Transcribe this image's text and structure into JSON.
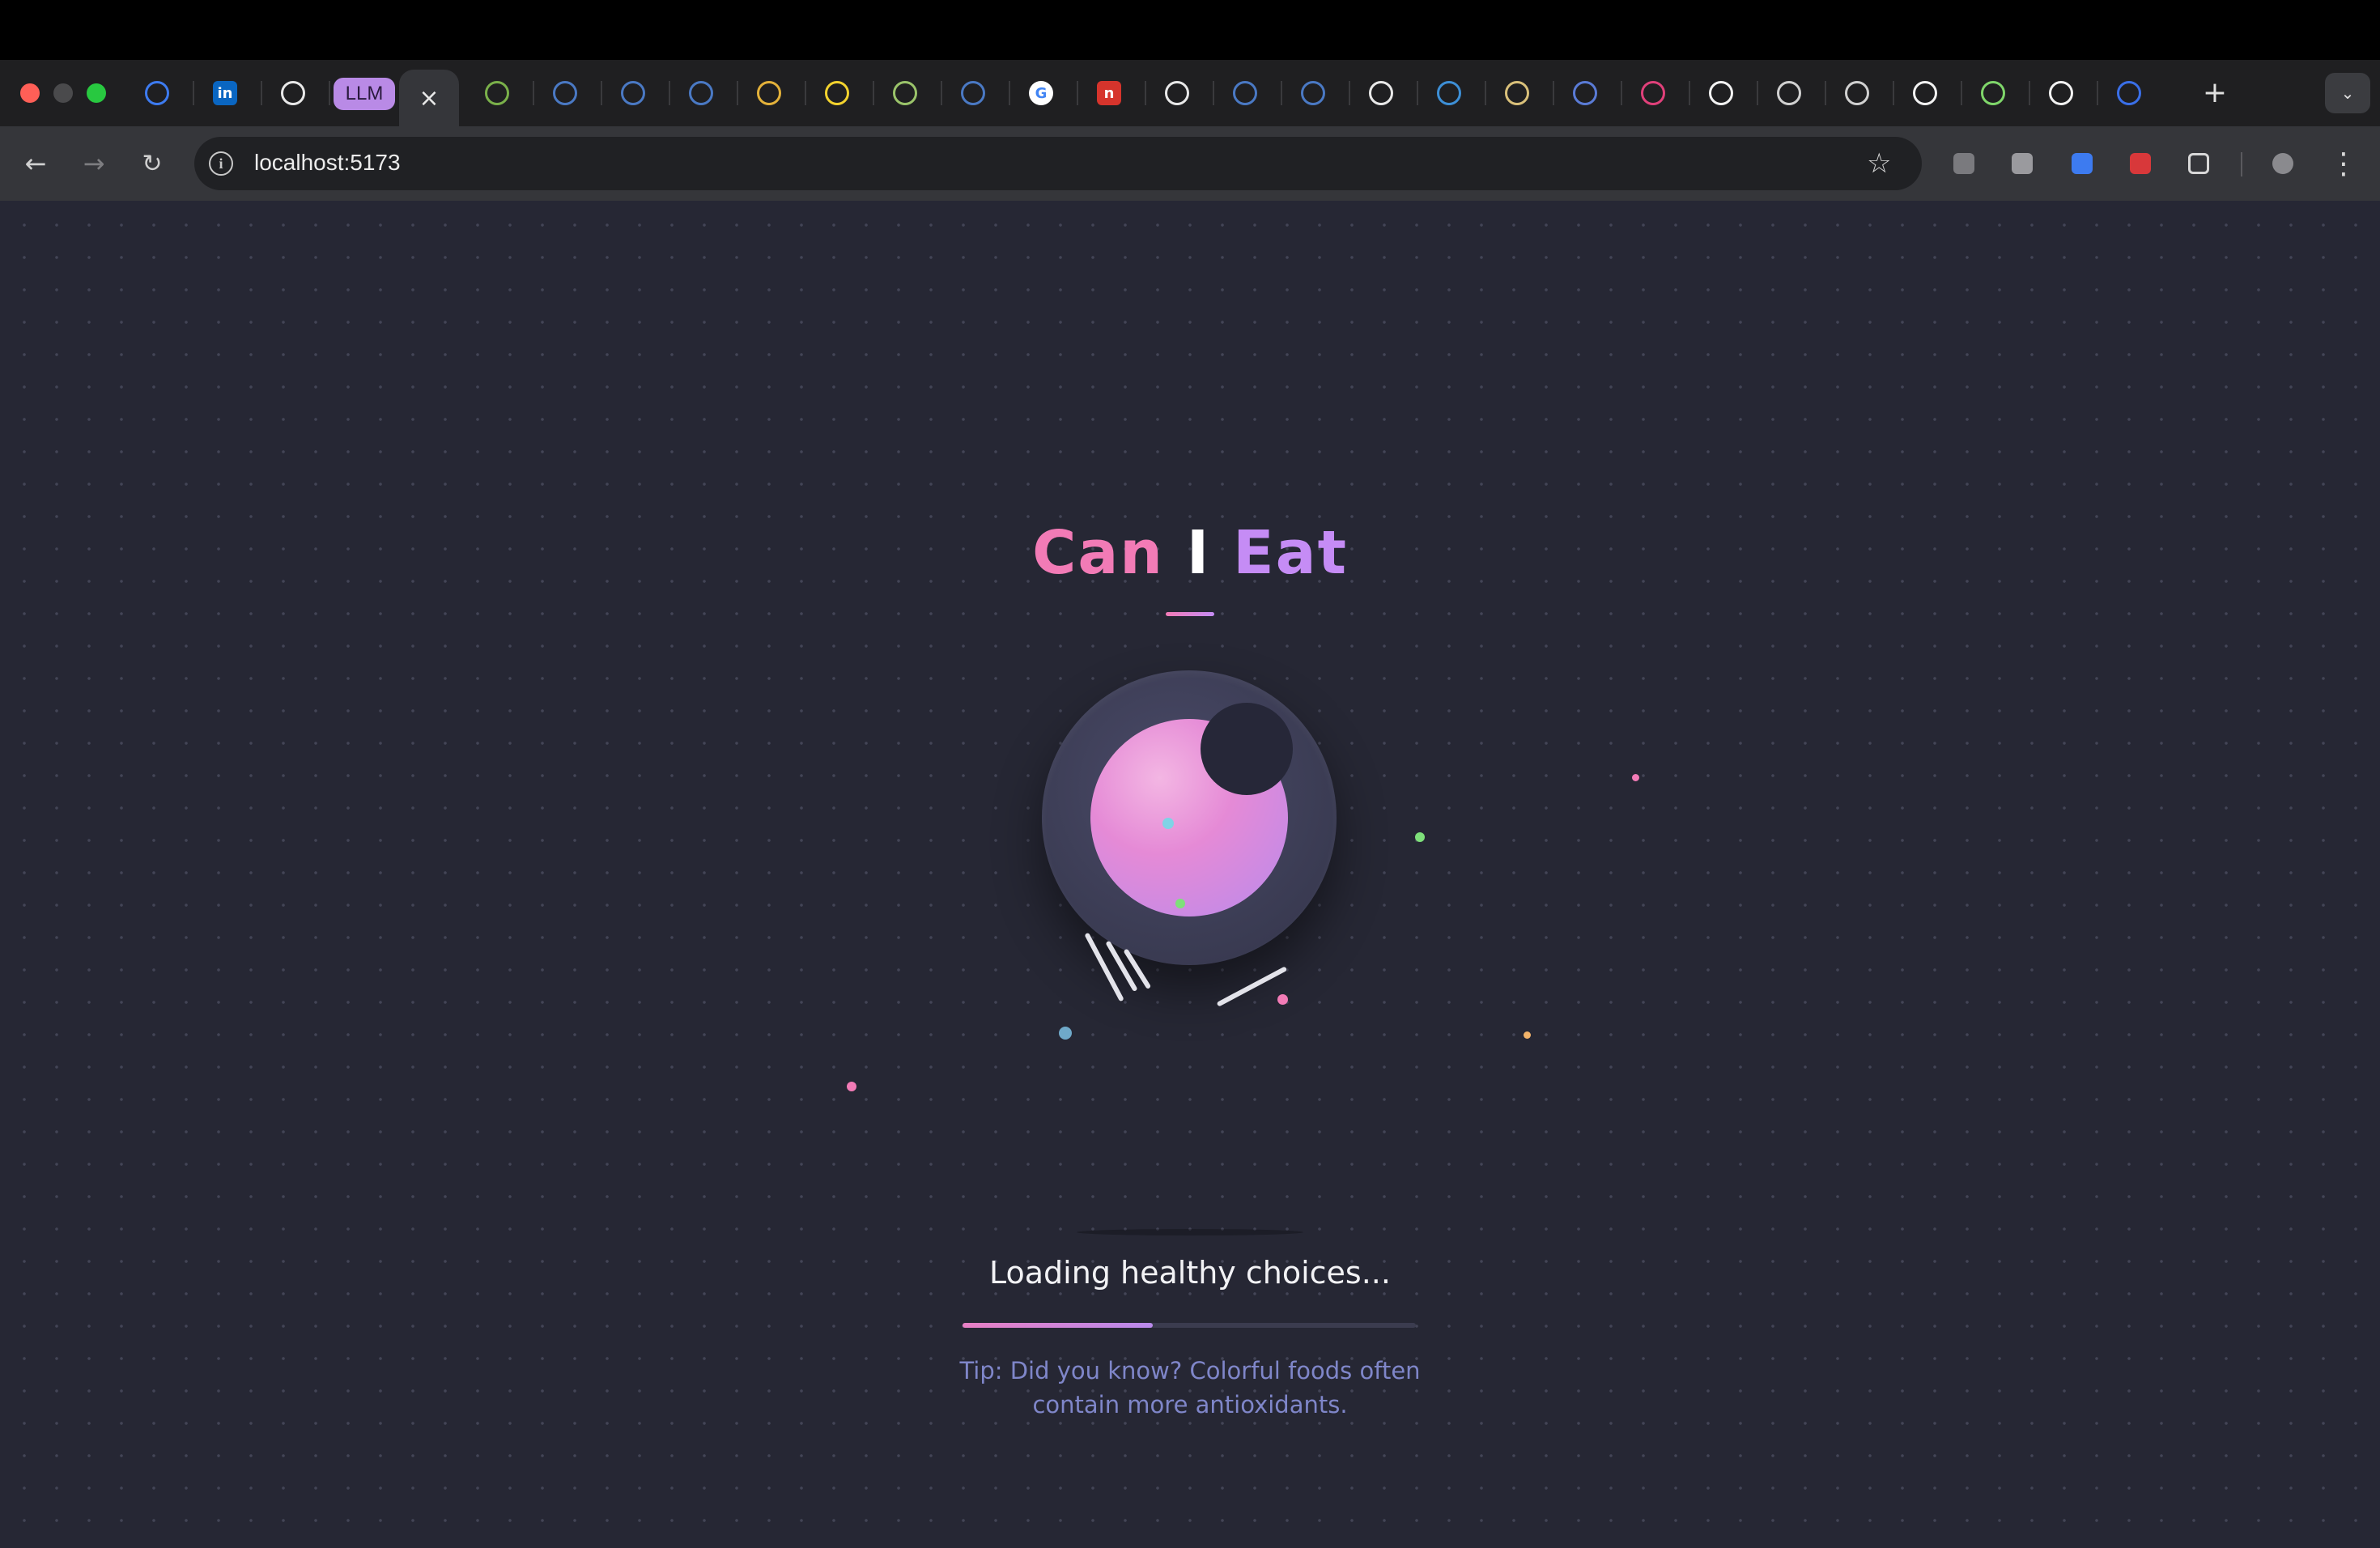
{
  "browser": {
    "url": "localhost:5173",
    "tabs": [
      {
        "icon": "sapphire-gem-icon",
        "color": "#3d7bf0"
      },
      {
        "icon": "linkedin-icon",
        "label": "in",
        "color": "#0a66c2"
      },
      {
        "icon": "openai-icon",
        "color": "#e8e8e8"
      },
      {
        "icon": "llm-pill-icon",
        "label": "LLM",
        "color": "#b98ae6"
      },
      {
        "icon": "close-icon",
        "active": true
      },
      {
        "icon": "image-gallery-icon",
        "color": "#7ab04a"
      },
      {
        "icon": "circle-app-icon",
        "color": "#4a79c4"
      },
      {
        "icon": "wave-app-icon",
        "color": "#4a79c4"
      },
      {
        "icon": "circle-app-icon",
        "color": "#4a79c4"
      },
      {
        "icon": "chrome-like-icon",
        "color": "#e3b13a"
      },
      {
        "icon": "yellow-cloud-icon",
        "color": "#f2d22e"
      },
      {
        "icon": "green-globe-icon",
        "color": "#9ac36a"
      },
      {
        "icon": "wave-app-icon",
        "color": "#4a79c4"
      },
      {
        "icon": "google-icon",
        "label": "G",
        "color": "#4285f4"
      },
      {
        "icon": "red-n-icon",
        "label": "n",
        "color": "#d6342c"
      },
      {
        "icon": "github-icon",
        "color": "#e8e8e8"
      },
      {
        "icon": "circle-app-icon",
        "color": "#4a79c4"
      },
      {
        "icon": "circle-app-icon",
        "color": "#4a79c4"
      },
      {
        "icon": "openai-icon",
        "color": "#e8e8e8"
      },
      {
        "icon": "play-icon",
        "color": "#3d8fd6"
      },
      {
        "icon": "avatar-icon",
        "color": "#d9c07a"
      },
      {
        "icon": "chat-bubble-icon",
        "color": "#5a7bd6"
      },
      {
        "icon": "react-icon",
        "color": "#e0407a"
      },
      {
        "icon": "bolt-icon",
        "color": "#f2f2f2"
      },
      {
        "icon": "globe-icon",
        "color": "#d0d0d0"
      },
      {
        "icon": "globe-icon",
        "color": "#d0d0d0"
      },
      {
        "icon": "bolt-icon",
        "color": "#f2f2f2"
      },
      {
        "icon": "bolt-icon",
        "color": "#7fd66a"
      },
      {
        "icon": "bolt-icon",
        "color": "#f2f2f2"
      },
      {
        "icon": "bitwarden-shield-icon",
        "color": "#3a6fe8"
      }
    ],
    "extensions": [
      {
        "icon": "pin-extension-icon",
        "color": "#7a7a7e"
      },
      {
        "icon": "mouse-extension-icon",
        "color": "#9a9a9e"
      },
      {
        "icon": "sapphire-extension-icon",
        "color": "#3d7bf0"
      },
      {
        "icon": "red-grid-extension-icon",
        "color": "#d8383a"
      },
      {
        "icon": "puzzle-extensions-icon",
        "color": "#d8d8d8"
      },
      {
        "icon": "profile-avatar-icon",
        "color": "#8a8a8e"
      }
    ]
  },
  "page": {
    "logo": {
      "can": "Can",
      "i": "I",
      "eat": "Eat"
    },
    "loading_text": "Loading healthy choices...",
    "progress": 0.42,
    "tip": "Tip: Did you know? Colorful foods often contain more antioxidants.",
    "colors": {
      "accent_pink": "#f27bb6",
      "accent_purple": "#c58cf5",
      "background": "#262734",
      "tip_text": "#7f86c9"
    }
  }
}
